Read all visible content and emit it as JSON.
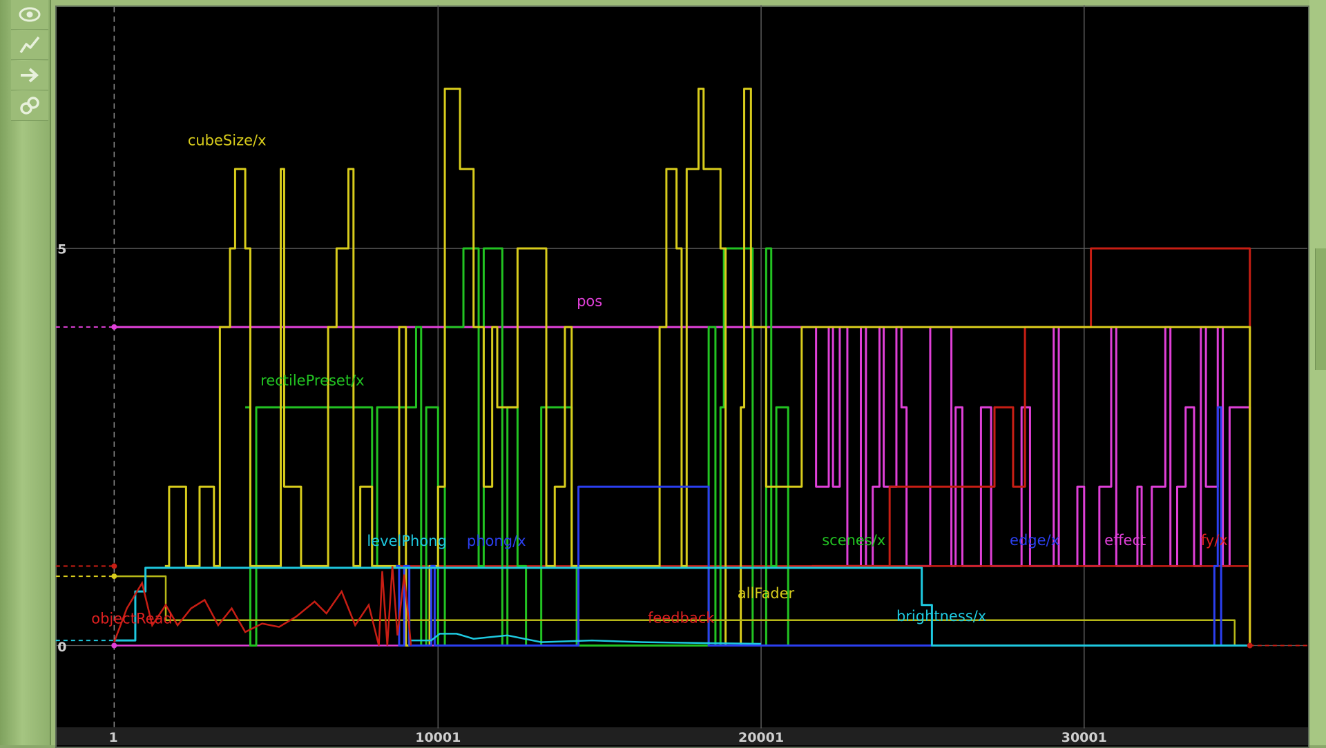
{
  "toolbar": {
    "tools": [
      {
        "icon": "eye-icon"
      },
      {
        "icon": "curve-icon"
      },
      {
        "icon": "arrow-right-icon"
      },
      {
        "icon": "link-icon"
      }
    ]
  },
  "graph": {
    "x_ticks": [
      "1",
      "10001",
      "20001",
      "30001"
    ],
    "y_ticks": [
      "5",
      "0"
    ],
    "curve_labels": [
      {
        "text": "cubeSize/x",
        "color": "#d8cc1c"
      },
      {
        "text": "pos",
        "color": "#e040d8"
      },
      {
        "text": "rectilePreset/x",
        "color": "#22c322"
      },
      {
        "text": "levelPhong",
        "color": "#1ec9e0"
      },
      {
        "text": "phong/x",
        "color": "#2b3ff0"
      },
      {
        "text": "scenes/x",
        "color": "#22c322"
      },
      {
        "text": "edge/x",
        "color": "#2b3ff0"
      },
      {
        "text": "effect",
        "color": "#e040d8"
      },
      {
        "text": "fy/x",
        "color": "#e02020"
      },
      {
        "text": "allFader",
        "color": "#d8cc1c"
      },
      {
        "text": "objectRead",
        "color": "#e02020"
      },
      {
        "text": "feedback",
        "color": "#e02020"
      },
      {
        "text": "brightness/x",
        "color": "#1ec9e0"
      }
    ],
    "colors": {
      "background": "#000000",
      "grid": "#5a5a5a",
      "yellow": "#d8cc1c",
      "green": "#22c322",
      "magenta": "#e040d8",
      "blue": "#2b3ff0",
      "cyan": "#1ec9e0",
      "red": "#c81e14",
      "olive": "#b7b818"
    }
  }
}
